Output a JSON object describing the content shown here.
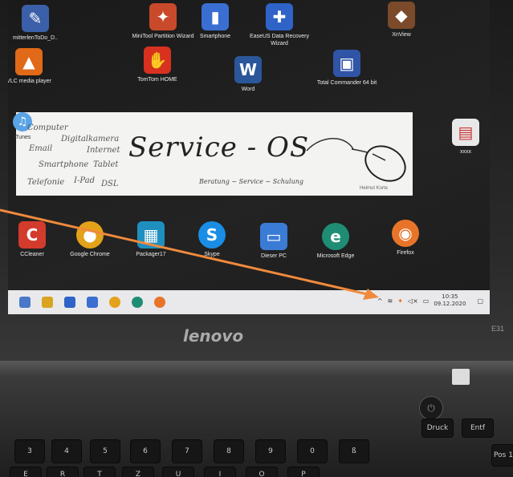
{
  "desktop": {
    "icons": [
      {
        "name": "notepad-icon",
        "label": "mitterlenToDo_D..",
        "color": "#3b5fa8",
        "glyph": "✎"
      },
      {
        "name": "minitool-icon",
        "label": "MiniTool Partition Wizard",
        "color": "#c84a2a",
        "glyph": "✦"
      },
      {
        "name": "smartphone-icon",
        "label": "Smartphone",
        "color": "#3a6fd1",
        "glyph": "▮"
      },
      {
        "name": "easeus-icon",
        "label": "EaseUS Data Recovery Wizard",
        "color": "#2f63c7",
        "glyph": "✚"
      },
      {
        "name": "xnview-icon",
        "label": "XnView",
        "color": "#7a4a2a",
        "glyph": "◆"
      },
      {
        "name": "vlc-icon",
        "label": "VLC media player",
        "color": "#e06a17",
        "glyph": "▲"
      },
      {
        "name": "tomtom-icon",
        "label": "TomTom HOME",
        "color": "#d8311f",
        "glyph": "✋"
      },
      {
        "name": "word-icon",
        "label": "Word",
        "color": "#2b579a",
        "glyph": "W"
      },
      {
        "name": "totalcommander-icon",
        "label": "Total Commander 64 bit",
        "color": "#3054a6",
        "glyph": "▣"
      },
      {
        "name": "itunes-icon",
        "label": "iTunes",
        "color": "#5aa3e6",
        "glyph": "♫"
      },
      {
        "name": "pdf-file-icon",
        "label": "xxxx",
        "color": "#e8e8e8",
        "glyph": "▤"
      },
      {
        "name": "ccleaner-icon",
        "label": "CCleaner",
        "color": "#d33b2c",
        "glyph": "C"
      },
      {
        "name": "chrome-icon",
        "label": "Google Chrome",
        "color": "#e3a21a",
        "glyph": "●"
      },
      {
        "name": "packager-icon",
        "label": "Packager17",
        "color": "#1f8fbf",
        "glyph": "▦"
      },
      {
        "name": "skype-icon",
        "label": "Skype",
        "color": "#1a8ee6",
        "glyph": "S"
      },
      {
        "name": "this-pc-icon",
        "label": "Dieser PC",
        "color": "#3a7bd5",
        "glyph": "▭"
      },
      {
        "name": "edge-icon",
        "label": "Microsoft Edge",
        "color": "#1f8d74",
        "glyph": "e"
      },
      {
        "name": "firefox-icon",
        "label": "Firefox",
        "color": "#e8742a",
        "glyph": "◉"
      }
    ]
  },
  "banner": {
    "brand": "Service - OS",
    "tagline": "Beratung ~ Service ~ Schulung",
    "author": "Helmut Korte",
    "words": [
      "Computer",
      "Digitalkamera",
      "Email",
      "Internet",
      "Smartphone",
      "Tablet",
      "Telefonie",
      "I-Pad",
      "DSL"
    ]
  },
  "taskbar": {
    "clock_time": "10:35",
    "clock_date": "09.12.2020",
    "tray_caret": "^"
  },
  "laptop": {
    "brand": "lenovo",
    "model": "E31"
  },
  "keyboard": {
    "keys": [
      "Druck",
      "Entf",
      "Pos 1",
      "3",
      "4",
      "5",
      "6",
      "7",
      "8",
      "9",
      "0",
      "ß",
      "E",
      "R",
      "T",
      "Z",
      "U",
      "I",
      "O",
      "P"
    ]
  },
  "colors": {
    "arrow": "#f08a3c",
    "taskbar": "#e9e9ec",
    "banner": "#f3f3f1"
  }
}
